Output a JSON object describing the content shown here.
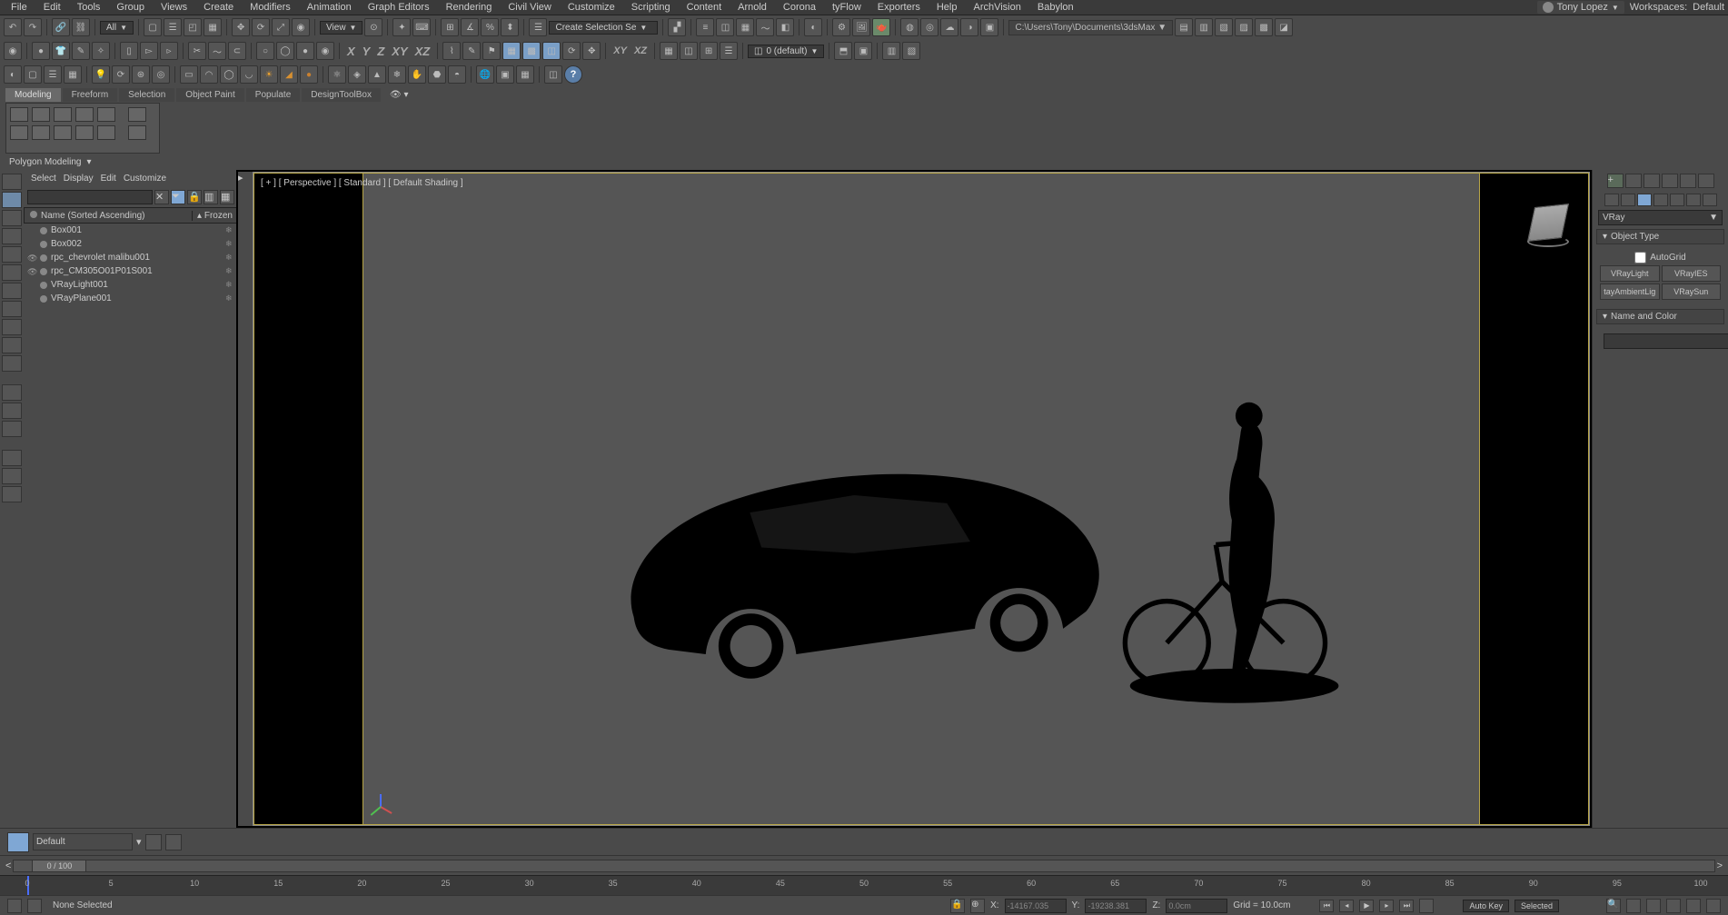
{
  "menubar": {
    "items": [
      "File",
      "Edit",
      "Tools",
      "Group",
      "Views",
      "Create",
      "Modifiers",
      "Animation",
      "Graph Editors",
      "Rendering",
      "Civil View",
      "Customize",
      "Scripting",
      "Content",
      "Arnold",
      "Corona",
      "tyFlow",
      "Exporters",
      "Help",
      "ArchVision",
      "Babylon"
    ],
    "user": "Tony Lopez",
    "workspaces_label": "Workspaces:",
    "workspaces_value": "Default"
  },
  "toolbar1": {
    "filter_dropdown": "All",
    "view_dropdown": "View",
    "selset_dropdown": "Create Selection Se",
    "filepath": "C:\\Users\\Tony\\Documents\\3dsMax"
  },
  "toolbar2": {
    "axes": [
      "X",
      "Y",
      "Z",
      "XY",
      "XZ"
    ],
    "named_sel": "0 (default)"
  },
  "ribbon": {
    "tabs": [
      "Modeling",
      "Freeform",
      "Selection",
      "Object Paint",
      "Populate",
      "DesignToolBox"
    ],
    "panel_title": "Polygon Modeling"
  },
  "scene_explorer": {
    "tabs": [
      "Select",
      "Display",
      "Edit",
      "Customize"
    ],
    "col_name": "Name (Sorted Ascending)",
    "col_frozen": "Frozen",
    "items": [
      {
        "name": "Box001",
        "vis": false
      },
      {
        "name": "Box002",
        "vis": false
      },
      {
        "name": "rpc_chevrolet malibu001",
        "vis": true
      },
      {
        "name": "rpc_CM305O01P01S001",
        "vis": true
      },
      {
        "name": "VRayLight001",
        "vis": false
      },
      {
        "name": "VRayPlane001",
        "vis": false
      }
    ]
  },
  "viewport": {
    "label": "[ + ] [ Perspective ] [ Standard ] [ Default Shading ]"
  },
  "command_panel": {
    "renderer": "VRay",
    "rollout_objtype": "Object Type",
    "autogrid": "AutoGrid",
    "types": [
      "VRayLight",
      "VRayIES",
      "tayAmbientLig",
      "VRaySun"
    ],
    "rollout_name": "Name and Color"
  },
  "layer_bar": {
    "layer_name": "Default"
  },
  "time": {
    "slider": "0 / 100",
    "ticks": [
      0,
      5,
      10,
      15,
      20,
      25,
      30,
      35,
      40,
      45,
      50,
      55,
      60,
      65,
      70,
      75,
      80,
      85,
      90,
      95,
      100
    ]
  },
  "status": {
    "selection": "None Selected",
    "x_lbl": "X:",
    "x": "-14167.035",
    "y_lbl": "Y:",
    "y": "-19238.381",
    "z_lbl": "Z:",
    "z": "0.0cm",
    "grid": "Grid = 10.0cm",
    "autokey": "Auto Key",
    "selected": "Selected"
  }
}
